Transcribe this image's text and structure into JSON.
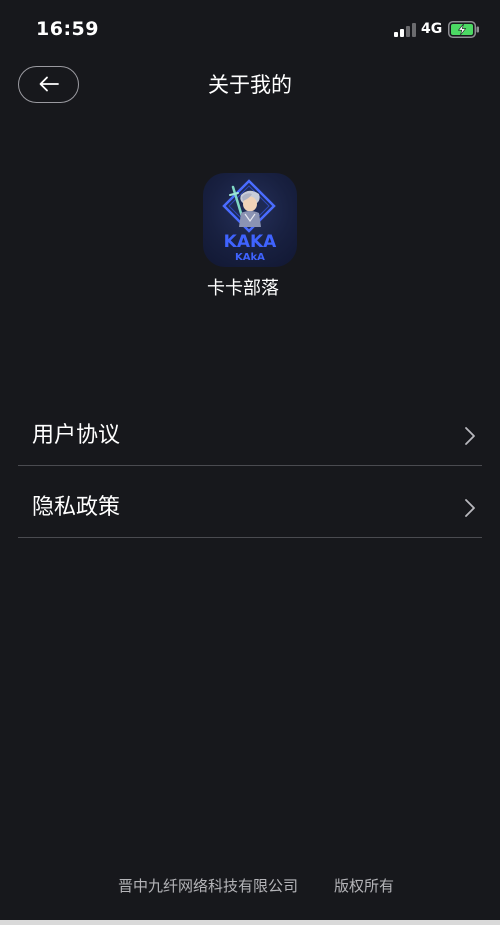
{
  "status_bar": {
    "time": "16:59",
    "network": "4G",
    "signal_bars": 2,
    "battery_charging": true,
    "battery_color": "#4cd964"
  },
  "header": {
    "title": "关于我的",
    "back_icon": "arrow-left-icon"
  },
  "app": {
    "logo_text": "KAKA",
    "logo_subtext": "KAkA",
    "name": "卡卡部落",
    "accent_color": "#3f63ff"
  },
  "menu": [
    {
      "label": "用户协议",
      "icon": "chevron-right-icon"
    },
    {
      "label": "隐私政策",
      "icon": "chevron-right-icon"
    }
  ],
  "footer": {
    "company": "晋中九纤网络科技有限公司",
    "rights": "版权所有"
  },
  "colors": {
    "background": "#17181c",
    "divider": "#4a4b50",
    "footer_text": "#b4b4b8"
  }
}
